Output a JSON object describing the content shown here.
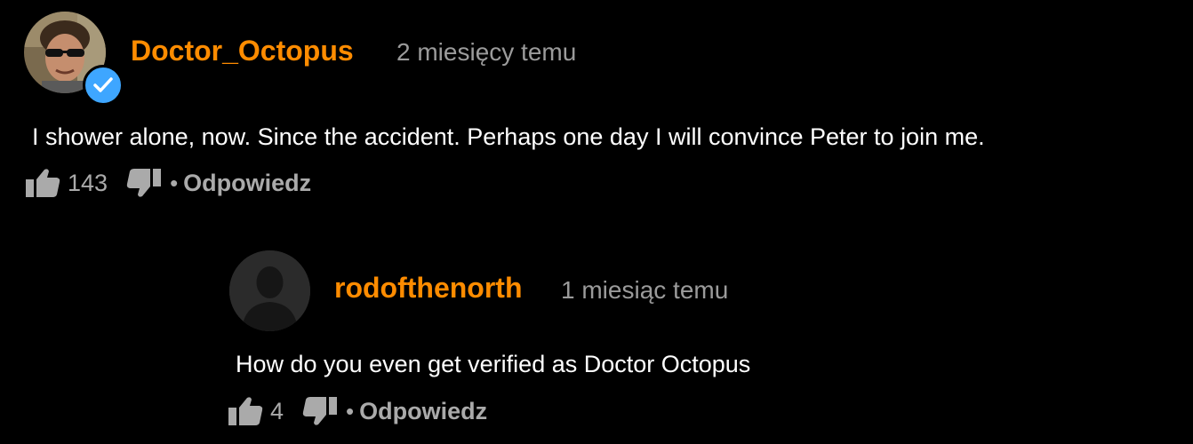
{
  "comments": [
    {
      "username": "Doctor_Octopus",
      "timestamp": "2 miesięcy temu",
      "verified": true,
      "text": "I shower alone, now. Since the accident. Perhaps one day I will convince Peter to join me.",
      "likes": "143",
      "separator": "•",
      "reply_label": "Odpowiedz"
    },
    {
      "username": "rodofthenorth",
      "timestamp": "1 miesiąc temu",
      "verified": false,
      "text": "How do you even get verified as Doctor Octopus",
      "likes": "4",
      "separator": "•",
      "reply_label": "Odpowiedz"
    }
  ],
  "icons": {
    "like": "thumbs-up-icon",
    "dislike": "thumbs-down-icon",
    "verified": "verified-check-icon"
  },
  "colors": {
    "background": "#000000",
    "username": "#ff8c00",
    "timestamp": "#9b9b9b",
    "text": "#ffffff",
    "actions": "#aaaaaa",
    "verified_badge": "#3ea6ff"
  }
}
